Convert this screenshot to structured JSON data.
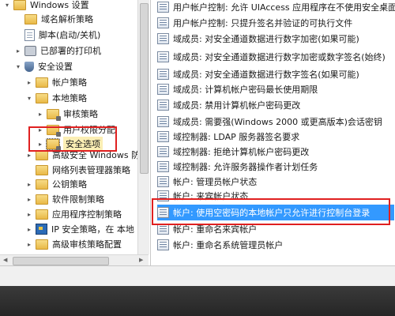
{
  "tree": {
    "items": [
      {
        "label": "Windows 设置",
        "icon": "folder-icon",
        "expander": "▾"
      },
      {
        "label": "域名解析策略",
        "icon": "folder-icon",
        "expander": ""
      },
      {
        "label": "脚本(启动/关机)",
        "icon": "script-icon",
        "expander": ""
      },
      {
        "label": "已部署的打印机",
        "icon": "printer-icon",
        "expander": "▸"
      },
      {
        "label": "安全设置",
        "icon": "shield-icon",
        "expander": "▾"
      },
      {
        "label": "帐户策略",
        "icon": "folder-icon",
        "expander": "▸"
      },
      {
        "label": "本地策略",
        "icon": "folder-icon",
        "expander": "▾"
      },
      {
        "label": "审核策略",
        "icon": "folder-icon",
        "expander": "▸"
      },
      {
        "label": "用户权限分配",
        "icon": "folder-icon",
        "expander": "▸"
      },
      {
        "label": "安全选项",
        "icon": "folder-icon",
        "expander": "▸"
      },
      {
        "label": "高级安全 Windows 防",
        "icon": "folder-icon",
        "expander": "▸"
      },
      {
        "label": "网络列表管理器策略",
        "icon": "folder-icon",
        "expander": ""
      },
      {
        "label": "公钥策略",
        "icon": "folder-icon",
        "expander": "▸"
      },
      {
        "label": "软件限制策略",
        "icon": "folder-icon",
        "expander": "▸"
      },
      {
        "label": "应用程序控制策略",
        "icon": "folder-icon",
        "expander": "▸"
      },
      {
        "label": "IP 安全策略，在 本地",
        "icon": "ip-security-icon",
        "expander": "▸"
      },
      {
        "label": "高级审核策略配置",
        "icon": "folder-icon",
        "expander": "▸"
      }
    ]
  },
  "policies": [
    "用户帐户控制: 允许 UIAccess 应用程序在不使用安全桌面",
    "用户帐户控制: 只提升签名并验证的可执行文件",
    "域成员: 对安全通道数据进行数字加密(如果可能)",
    "域成员: 对安全通道数据进行数字加密或数字签名(始终)",
    "域成员: 对安全通道数据进行数字签名(如果可能)",
    "域成员: 计算机帐户密码最长使用期限",
    "域成员: 禁用计算机帐户密码更改",
    "域成员: 需要强(Windows 2000 或更高版本)会话密钥",
    "域控制器: LDAP 服务器签名要求",
    "域控制器: 拒绝计算机帐户密码更改",
    "域控制器: 允许服务器操作者计划任务",
    "帐户: 管理员帐户状态",
    "帐户: 来宾帐户状态",
    "帐户: 使用空密码的本地帐户只允许进行控制台登录",
    "帐户: 重命名来宾帐户",
    "帐户: 重命名系统管理员帐户"
  ],
  "colors": {
    "annotation": "#e02020",
    "selection": "#3399ff",
    "taskbar": "#2e2e2e"
  }
}
